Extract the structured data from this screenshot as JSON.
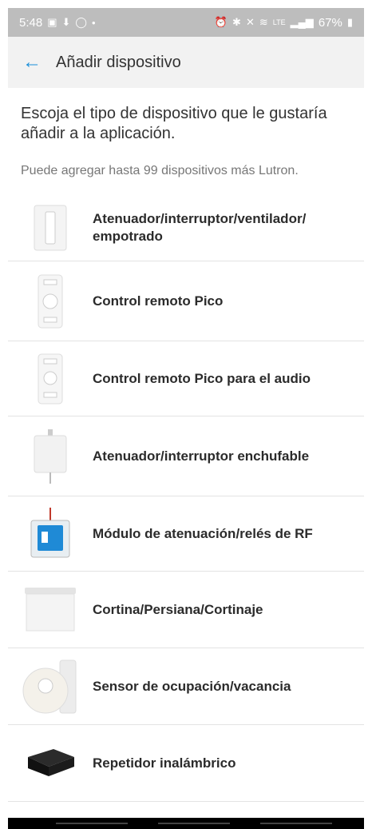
{
  "status": {
    "time": "5:48",
    "left_icons": [
      "gallery-icon",
      "download-icon",
      "whatsapp-icon",
      "dot-icon"
    ],
    "right_icons": [
      "alarm-icon",
      "bluetooth-icon",
      "mute-icon",
      "wifi-icon",
      "signal-icon"
    ],
    "network": "LTE",
    "battery": "67%"
  },
  "header": {
    "title": "Añadir dispositivo"
  },
  "intro": "Escoja el tipo de dispositivo que le gustaría añadir a la aplicación.",
  "subtext": "Puede agregar hasta 99 dispositivos más Lutron.",
  "devices": [
    {
      "label": "Atenuador/interruptor/ventilador/ empotrado",
      "icon": "wall-dimmer-icon"
    },
    {
      "label": "Control remoto Pico",
      "icon": "pico-remote-icon"
    },
    {
      "label": "Control remoto Pico para el audio",
      "icon": "pico-audio-remote-icon"
    },
    {
      "label": "Atenuador/interruptor enchufable",
      "icon": "plug-in-dimmer-icon"
    },
    {
      "label": "Módulo de atenuación/relés de RF",
      "icon": "rf-module-icon"
    },
    {
      "label": "Cortina/Persiana/Cortinaje",
      "icon": "shade-icon"
    },
    {
      "label": "Sensor de ocupación/vacancia",
      "icon": "occupancy-sensor-icon"
    },
    {
      "label": "Repetidor inalámbrico",
      "icon": "wireless-repeater-icon"
    }
  ]
}
